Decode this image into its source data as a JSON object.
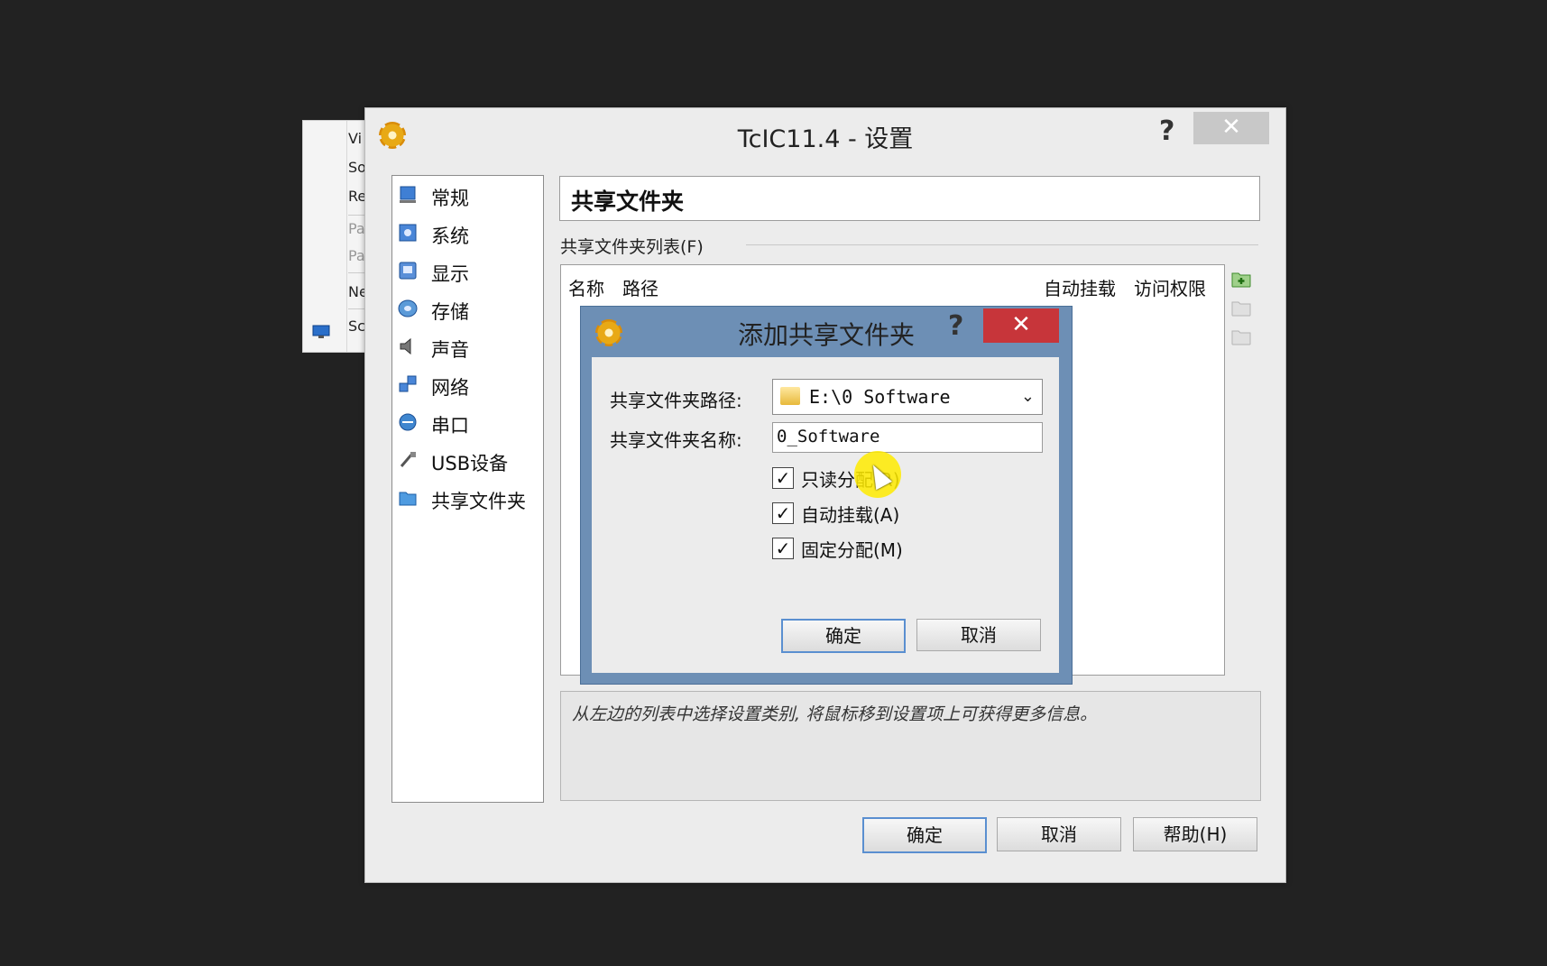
{
  "background_window": {
    "items": [
      "Vi",
      "So",
      "Re",
      "Pa",
      "Pa",
      "Ne",
      "Sc"
    ]
  },
  "window": {
    "title": "TcIC11.4 - 设置",
    "help_symbol": "?",
    "close_symbol": "✕"
  },
  "nav": {
    "items": [
      {
        "label": "常规",
        "icon": "general-icon"
      },
      {
        "label": "系统",
        "icon": "system-icon"
      },
      {
        "label": "显示",
        "icon": "display-icon"
      },
      {
        "label": "存储",
        "icon": "storage-icon"
      },
      {
        "label": "声音",
        "icon": "audio-icon"
      },
      {
        "label": "网络",
        "icon": "network-icon"
      },
      {
        "label": "串口",
        "icon": "serial-port-icon"
      },
      {
        "label": "USB设备",
        "icon": "usb-icon"
      },
      {
        "label": "共享文件夹",
        "icon": "shared-folder-icon"
      }
    ],
    "selected": "共享文件夹"
  },
  "page": {
    "header": "共享文件夹",
    "group_label": "共享文件夹列表(F)",
    "columns": {
      "name": "名称",
      "path": "路径",
      "auto_mount": "自动挂载",
      "access": "访问权限"
    },
    "info_text": "从左边的列表中选择设置类别, 将鼠标移到设置项上可获得更多信息。"
  },
  "buttons": {
    "ok": "确定",
    "cancel": "取消",
    "help": "帮助(H)"
  },
  "dialog": {
    "title": "添加共享文件夹",
    "help_symbol": "?",
    "close_symbol": "✕",
    "path_label": "共享文件夹路径:",
    "path_value": "E:\\0 Software",
    "name_label": "共享文件夹名称:",
    "name_value": "0_Software",
    "checkboxes": [
      {
        "label": "只读分配(R)",
        "checked": true
      },
      {
        "label": "自动挂载(A)",
        "checked": true
      },
      {
        "label": "固定分配(M)",
        "checked": true
      }
    ],
    "check_mark": "✓",
    "ok": "确定",
    "cancel": "取消"
  },
  "colors": {
    "dialog_frame": "#6d8fb5",
    "close_red": "#c7353a",
    "cursor_highlight": "#ffeb00"
  }
}
